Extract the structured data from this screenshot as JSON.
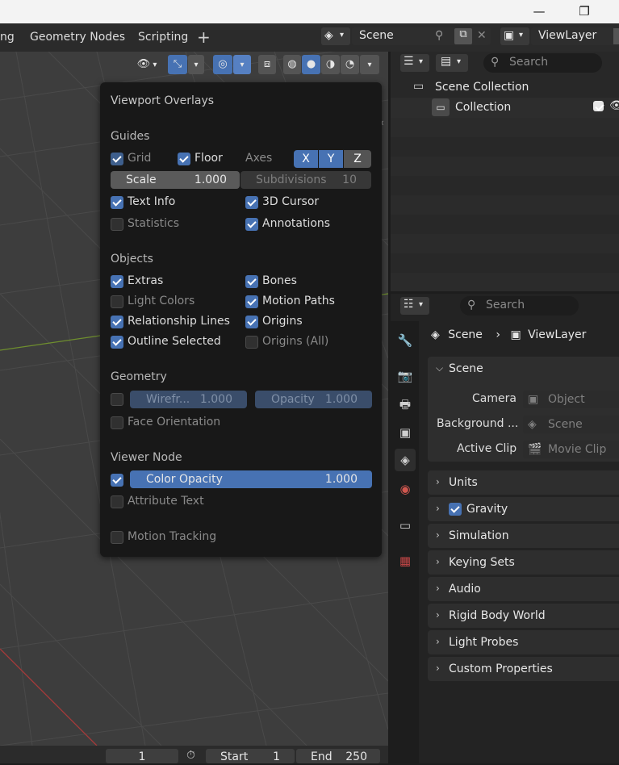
{
  "window": {
    "min_icon": "minimize-icon",
    "max_icon": "maximize-icon"
  },
  "topbar": {
    "tabs": [
      "ng",
      "Geometry Nodes",
      "Scripting"
    ],
    "add_tab": "+",
    "scene_name": "Scene",
    "view_layer": "ViewLayer"
  },
  "popover": {
    "title": "Viewport Overlays",
    "guides": {
      "heading": "Guides",
      "grid": "Grid",
      "floor": "Floor",
      "axes": "Axes",
      "axis_x": "X",
      "axis_y": "Y",
      "axis_z": "Z",
      "scale_label": "Scale",
      "scale_value": "1.000",
      "subdiv_label": "Subdivisions",
      "subdiv_value": "10",
      "text_info": "Text Info",
      "cursor": "3D Cursor",
      "statistics": "Statistics",
      "annotations": "Annotations"
    },
    "objects": {
      "heading": "Objects",
      "extras": "Extras",
      "bones": "Bones",
      "light_colors": "Light Colors",
      "motion_paths": "Motion Paths",
      "relationship_lines": "Relationship Lines",
      "origins": "Origins",
      "outline_selected": "Outline Selected",
      "origins_all": "Origins (All)"
    },
    "geometry": {
      "heading": "Geometry",
      "wireframe_label": "Wirefr...",
      "wireframe_value": "1.000",
      "opacity_label": "Opacity",
      "opacity_value": "1.000",
      "face_orientation": "Face Orientation"
    },
    "viewer_node": {
      "heading": "Viewer Node",
      "color_opacity_label": "Color Opacity",
      "color_opacity_value": "1.000",
      "attribute_text": "Attribute Text"
    },
    "motion_tracking": "Motion Tracking"
  },
  "outliner": {
    "search_placeholder": "Search",
    "scene_collection": "Scene Collection",
    "collection": "Collection"
  },
  "properties": {
    "search_placeholder": "Search",
    "breadcrumb_scene": "Scene",
    "breadcrumb_sep": "›",
    "breadcrumb_layer": "ViewLayer",
    "scene_panel": "Scene",
    "camera_label": "Camera",
    "camera_value": "Object",
    "background_label": "Background ...",
    "background_value": "Scene",
    "active_clip_label": "Active Clip",
    "active_clip_value": "Movie Clip",
    "panels": [
      "Units",
      "Gravity",
      "Simulation",
      "Keying Sets",
      "Audio",
      "Rigid Body World",
      "Light Probes",
      "Custom Properties"
    ]
  },
  "timeline": {
    "current_frame": "1",
    "start_label": "Start",
    "start_value": "1",
    "end_label": "End",
    "end_value": "250"
  },
  "colors": {
    "accent": "#4772b3",
    "background": "#1d1d1d",
    "panel": "#2e2e2e",
    "viewport": "#3d3d3d"
  }
}
